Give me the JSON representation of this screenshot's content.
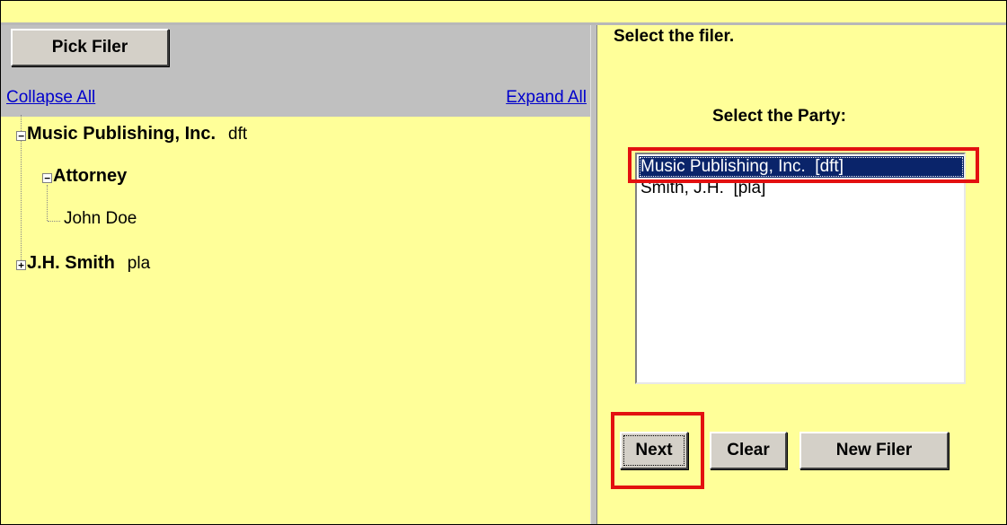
{
  "left": {
    "pick_filer_label": "Pick Filer",
    "collapse_all": "Collapse All",
    "expand_all": "Expand All",
    "tree": {
      "node1": {
        "name": "Music Publishing, Inc.",
        "role": "dft",
        "toggle": "−"
      },
      "node1_child": {
        "name": "Attorney",
        "toggle": "−"
      },
      "node1_leaf": {
        "name": "John Doe"
      },
      "node2": {
        "name": "J.H. Smith",
        "role": "pla",
        "toggle": "+"
      }
    }
  },
  "right": {
    "heading": "Select the filer.",
    "party_label": "Select the Party:",
    "party_options": [
      {
        "label": "Music Publishing, Inc.  [dft]",
        "selected": true
      },
      {
        "label": "Smith, J.H.  [pla]",
        "selected": false
      }
    ],
    "buttons": {
      "next": "Next",
      "clear": "Clear",
      "new_filer": "New Filer"
    }
  },
  "colors": {
    "background": "#ffff99",
    "panel_gray": "#c0c0c0",
    "selection": "#0a246a",
    "highlight_red": "#e31010",
    "link": "#0000cc"
  }
}
